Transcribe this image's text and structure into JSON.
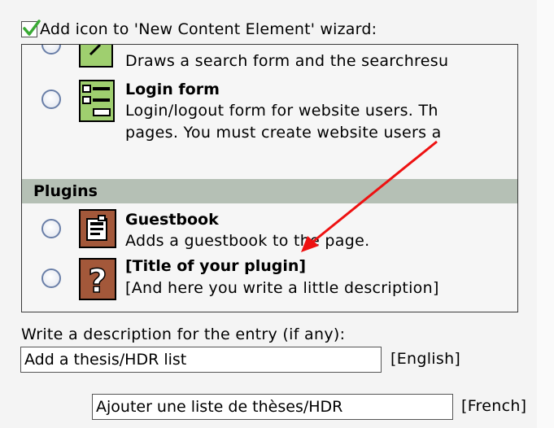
{
  "wizard_checkbox": {
    "label": "Add icon to 'New Content Element' wizard:",
    "checked": true
  },
  "elements": [
    {
      "title": "",
      "description": [
        "Draws a search form and the searchresu"
      ],
      "icon": "search-form-icon",
      "selected": false
    },
    {
      "title": "Login form",
      "description": [
        "Login/logout form for website users. Th",
        "pages. You must create website users a"
      ],
      "icon": "login-form-icon",
      "selected": false
    }
  ],
  "section": {
    "label": "Plugins"
  },
  "plugins": [
    {
      "title": "Guestbook",
      "description": [
        "Adds a guestbook to the page."
      ],
      "icon": "guestbook-icon",
      "selected": false
    },
    {
      "title": "[Title of your plugin]",
      "description": [
        "[And here you write a little description]"
      ],
      "icon": "question-mark-icon",
      "selected": false
    }
  ],
  "description_section": {
    "label": "Write a description for the entry (if any):",
    "english_value": "Add a thesis/HDR list",
    "english_lang": "[English]",
    "french_value": "Ajouter une liste de thèses/HDR",
    "french_lang": "[French]"
  },
  "colors": {
    "section_header_bg": "#b5c0b5",
    "arrow": "#ee1111",
    "check": "#3aaa35"
  }
}
